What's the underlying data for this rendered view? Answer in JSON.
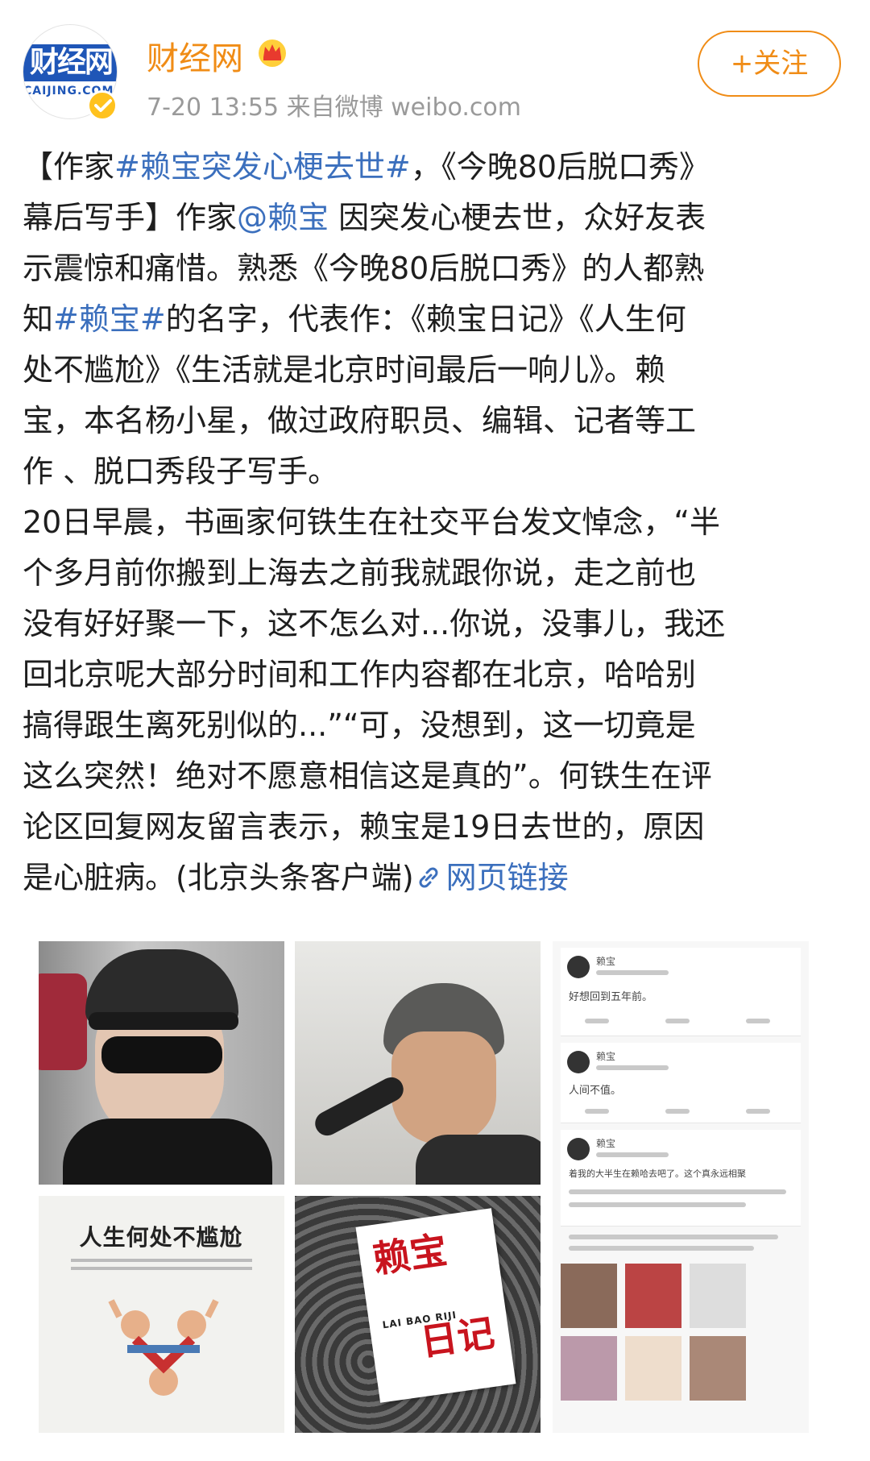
{
  "header": {
    "avatar_logo_main": "财经网",
    "avatar_logo_sub": "CAIJING.COM.CN",
    "username": "财经网",
    "meta": "7-20 13:55  来自微博 weibo.com",
    "follow_label": "+关注"
  },
  "post": {
    "lines": {
      "l1a": "【作家",
      "l1_topic": "#赖宝突发心梗去世#",
      "l1b": "，《今晚80后脱口秀》",
      "l2a": "幕后写手】作家",
      "l2_mention": "@赖宝",
      "l2b": " 因突发心梗去世，众好友表",
      "l3": "示震惊和痛惜。熟悉《今晚80后脱口秀》的人都熟",
      "l4a": "知",
      "l4_topic": "#赖宝#",
      "l4b": "的名字，代表作：《赖宝日记》《人生何",
      "l5": "处不尴尬》《生活就是北京时间最后一响儿》。赖",
      "l6": "宝，本名杨小星，做过政府职员、编辑、记者等工",
      "l7": "作 、脱口秀段子写手。",
      "l8": "20日早晨，书画家何铁生在社交平台发文悼念，“半",
      "l9": "个多月前你搬到上海去之前我就跟你说，走之前也",
      "l10": "没有好好聚一下，这不怎么对...你说，没事儿，我还",
      "l11": "回北京呢大部分时间和工作内容都在北京，哈哈别",
      "l12": "搞得跟生离死别似的...”“可，没想到，这一切竟是",
      "l13": "这么突然！绝对不愿意相信这是真的”。何铁生在评",
      "l14": "论区回复网友留言表示，赖宝是19日去世的，原因",
      "l15a": "是心脏病。(北京头条客户端)",
      "l15_link": "网页链接"
    }
  },
  "images": {
    "book1_title": "人生何处不尴尬",
    "book2_title_top": "赖宝",
    "book2_pinyin": "LAI BAO RIJI",
    "book2_title_bottom": "日记",
    "screenshot": {
      "name": "赖宝",
      "text1": "好想回到五年前。",
      "text2": "人间不值。",
      "text3": "着我的大半生在赖哈去吧了。这个真永远相聚"
    }
  },
  "colors": {
    "accent": "#f08c16",
    "link": "#3b6fbd",
    "text": "#1e1e1e",
    "meta": "#9a9a9a"
  },
  "icons": [
    "verified-badge-icon",
    "crown-icon",
    "link-icon"
  ]
}
